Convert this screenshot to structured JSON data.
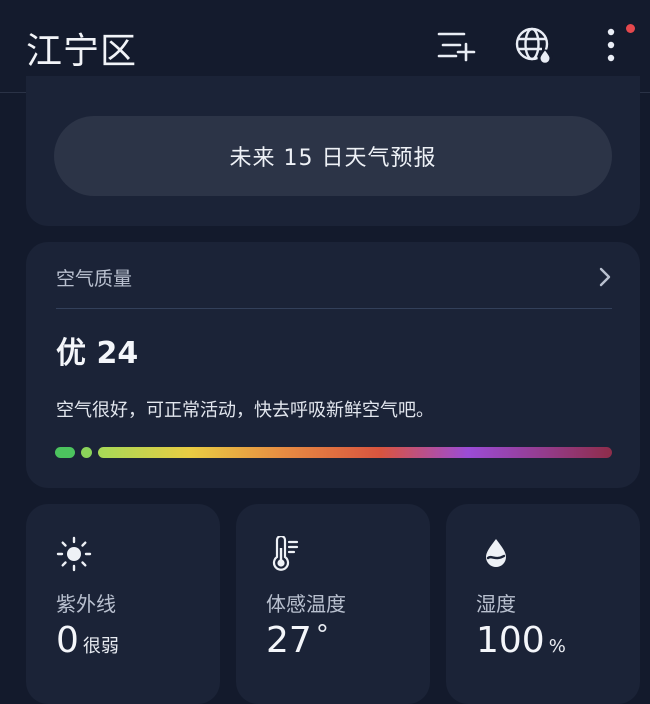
{
  "header": {
    "city": "江宁区",
    "icons": [
      "add-city-icon",
      "globe-icon",
      "more-icon"
    ]
  },
  "forecast": {
    "button_label": "未来 15 日天气预报"
  },
  "aqi": {
    "title": "空气质量",
    "level": "优 24",
    "description": "空气很好，可正常活动，快去呼吸新鲜空气吧。",
    "index_level_fraction": 0.05
  },
  "tiles": [
    {
      "icon": "sun-icon",
      "label": "紫外线",
      "value": "0",
      "unit": "很弱"
    },
    {
      "icon": "thermometer-icon",
      "label": "体感温度",
      "value": "27",
      "unit": "°"
    },
    {
      "icon": "humidity-drop-icon",
      "label": "湿度",
      "value": "100",
      "unit": "%"
    }
  ],
  "colors": {
    "background": "#131a2c",
    "card": "#1b2337",
    "notification_dot": "#e5484d",
    "aqi_good": "#4cc35e"
  }
}
